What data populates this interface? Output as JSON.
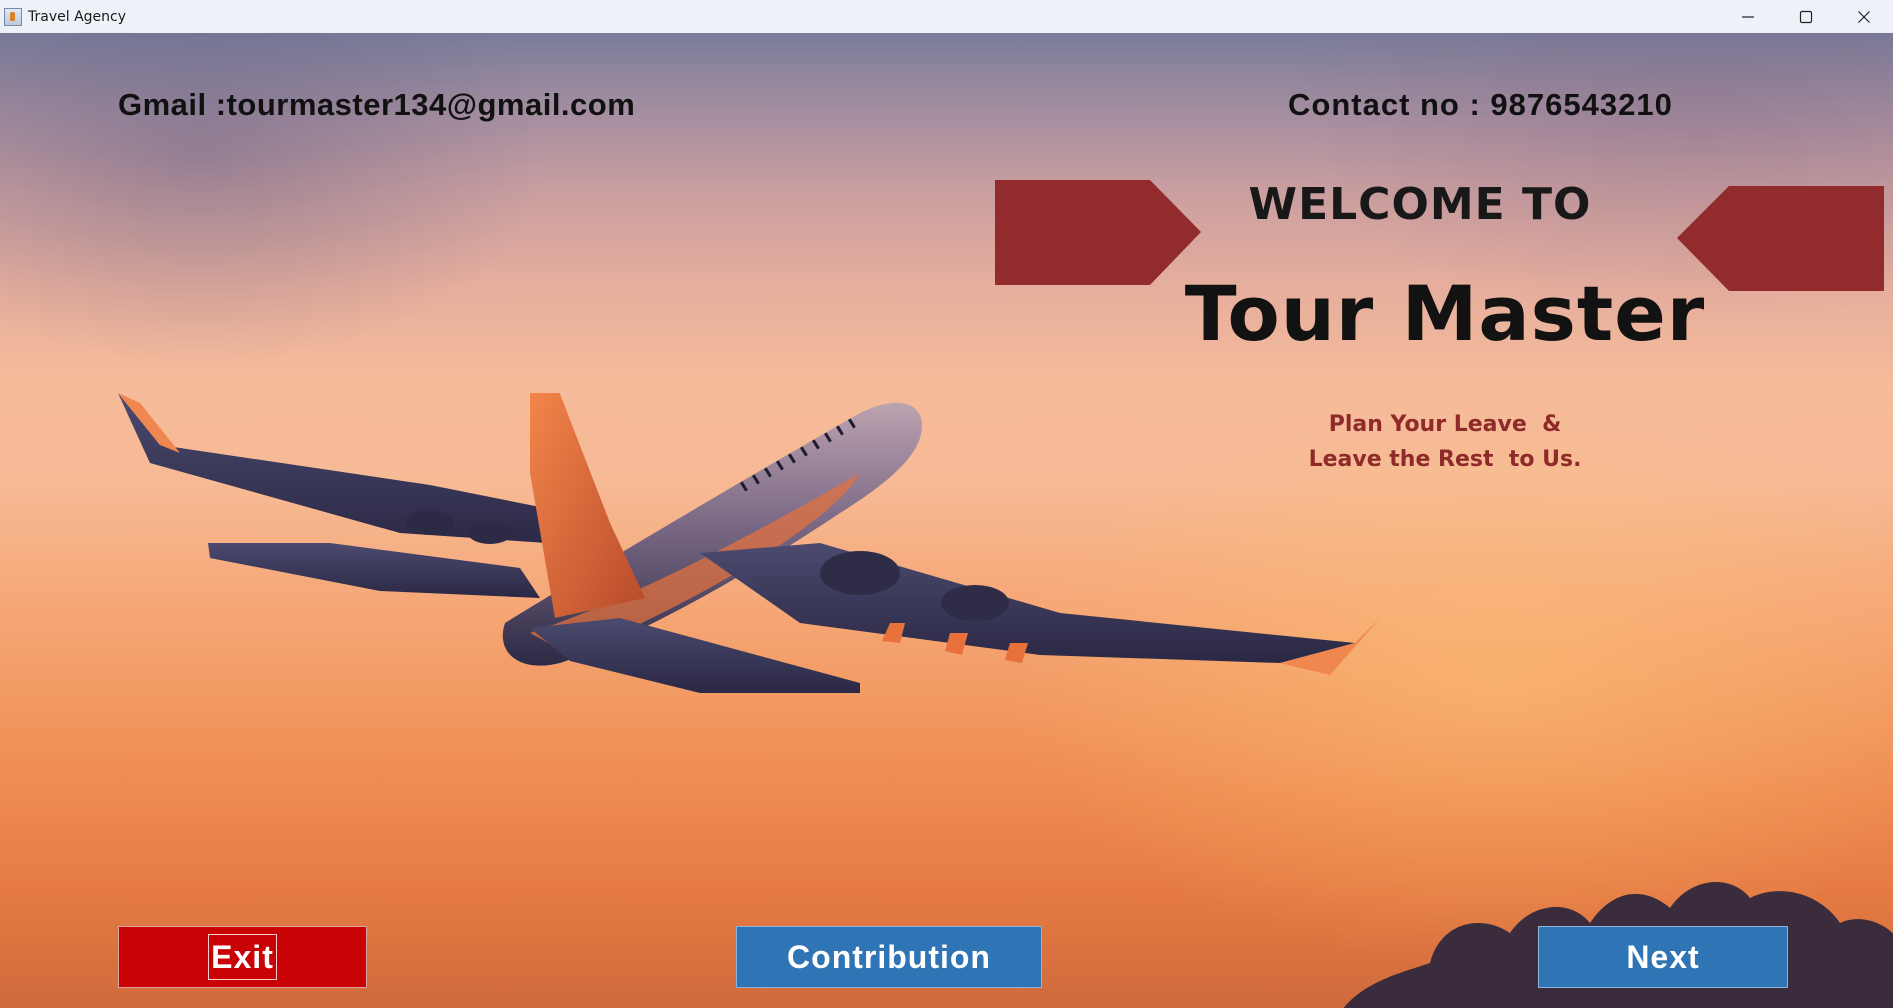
{
  "window": {
    "title": "Travel Agency",
    "controls": [
      "minimize",
      "maximize",
      "close"
    ]
  },
  "header": {
    "email": "Gmail :tourmaster134@gmail.com",
    "contact": "Contact no : 9876543210"
  },
  "hero": {
    "welcome": "WELCOME TO",
    "brand": "Tour Master",
    "tagline_line1": "Plan Your Leave  &",
    "tagline_line2": "Leave the Rest  to Us."
  },
  "buttons": {
    "exit": "Exit",
    "contribution": "Contribution",
    "next": "Next"
  },
  "colors": {
    "banner": "#922b2d",
    "exit_button": "#c80205",
    "action_button": "#2f74b5",
    "tagline": "#8e2a2a"
  },
  "icons": {
    "app": "java-cup-icon",
    "minimize": "minimize-icon",
    "maximize": "maximize-icon",
    "close": "close-icon"
  }
}
